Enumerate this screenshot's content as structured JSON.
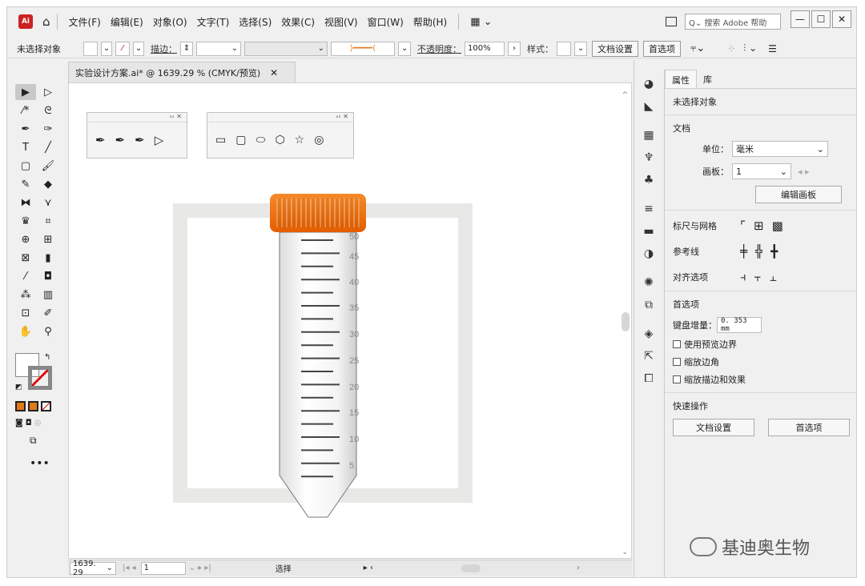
{
  "menubar": {
    "logo": "Ai",
    "items": [
      "文件(F)",
      "编辑(E)",
      "对象(O)",
      "文字(T)",
      "选择(S)",
      "效果(C)",
      "视图(V)",
      "窗口(W)",
      "帮助(H)"
    ],
    "search_placeholder": "搜索 Adobe 帮助"
  },
  "controlbar": {
    "selection_status": "未选择对象",
    "stroke_label": "描边：",
    "opacity_label": "不透明度：",
    "opacity_value": "100%",
    "style_label": "样式：",
    "doc_setup_button": "文档设置",
    "prefs_button": "首选项"
  },
  "document": {
    "tab_title": "实验设计方案.ai* @ 1639.29 % (CMYK/预览)",
    "scale_marks": [
      "50",
      "45",
      "40",
      "35",
      "30",
      "25",
      "20",
      "15",
      "10",
      "5"
    ]
  },
  "statusbar": {
    "zoom": "1639. 29",
    "artboard_number": "1",
    "tool_name": "选择"
  },
  "props": {
    "tabs": [
      "属性",
      "库"
    ],
    "no_selection": "未选择对象",
    "document_heading": "文档",
    "units_label": "单位：",
    "units_value": "毫米",
    "artboard_label": "画板：",
    "artboard_value": "1",
    "edit_artboards_button": "编辑画板",
    "rulers_grids_label": "标尺与网格",
    "guides_label": "参考线",
    "snap_options_label": "对齐选项",
    "prefs_heading": "首选项",
    "keyboard_increment_label": "键盘增量：",
    "keyboard_increment_value": "0. 353 mm",
    "checkboxes": [
      "使用预览边界",
      "缩放边角",
      "缩放描边和效果"
    ],
    "quick_actions_heading": "快速操作",
    "doc_setup_button": "文档设置",
    "prefs_button": "首选项"
  },
  "watermark": "基迪奥生物",
  "colors": {
    "cap_orange": "#f07a1a",
    "artboard_frame": "#e8e8e6",
    "app_bg": "#f0f0f0"
  }
}
